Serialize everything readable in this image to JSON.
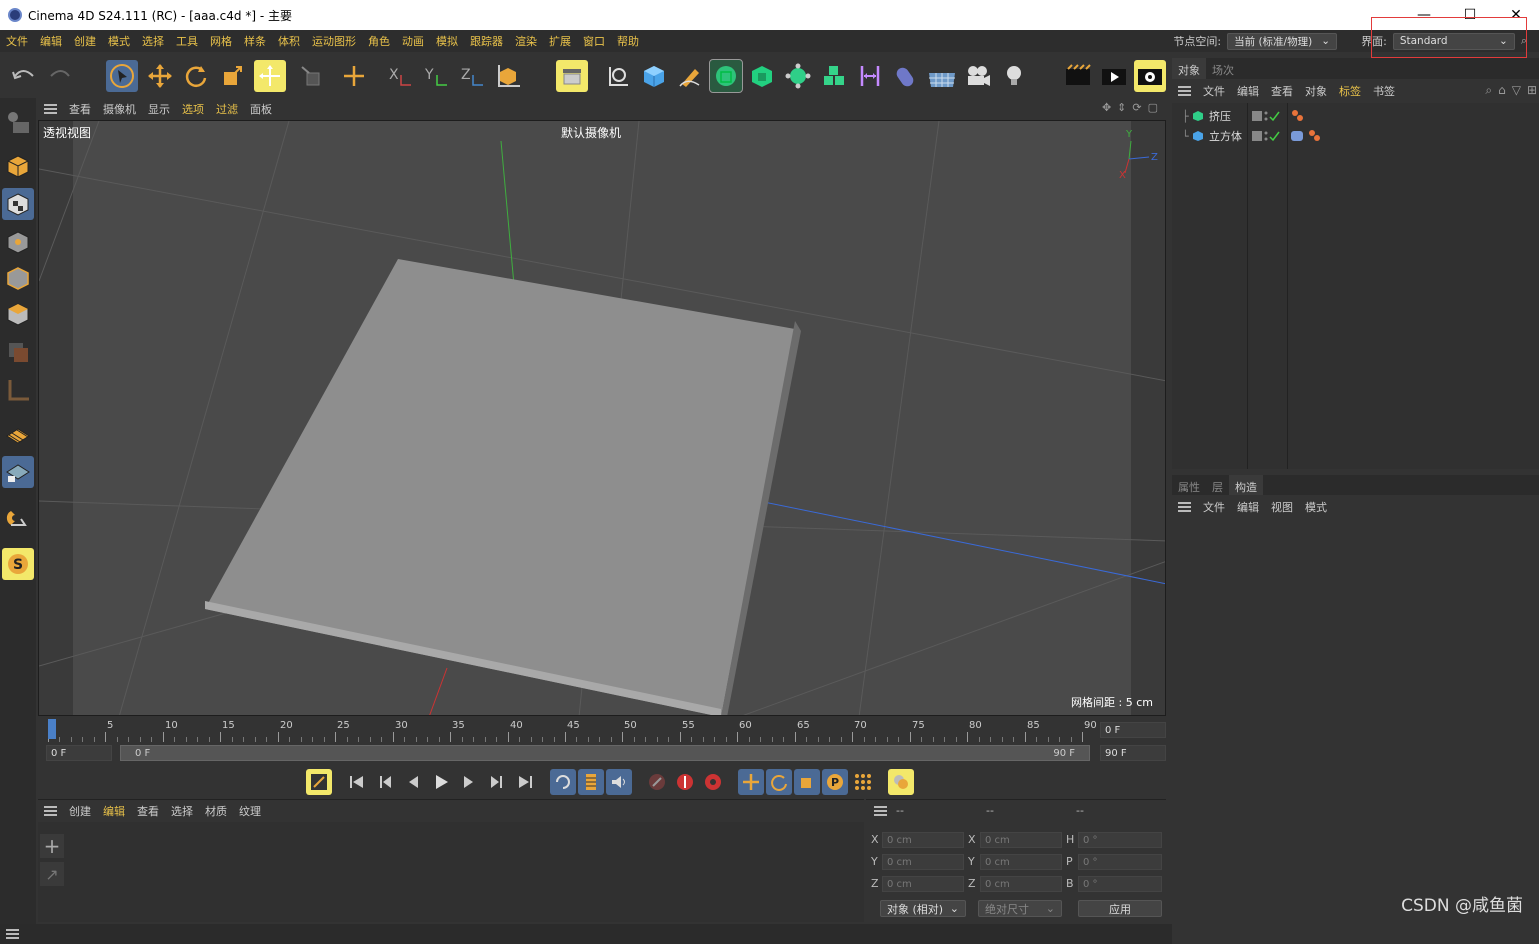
{
  "window": {
    "title": "Cinema 4D S24.111 (RC) - [aaa.c4d *] - 主要",
    "minimize": "—",
    "maximize": "☐",
    "close": "✕"
  },
  "menubar": {
    "items": [
      "文件",
      "编辑",
      "创建",
      "模式",
      "选择",
      "工具",
      "网格",
      "样条",
      "体积",
      "运动图形",
      "角色",
      "动画",
      "模拟",
      "跟踪器",
      "渲染",
      "扩展",
      "窗口",
      "帮助"
    ],
    "node_space_label": "节点空间:",
    "node_space_value": "当前 (标准/物理)",
    "layout_label": "界面:",
    "layout_value": "Standard"
  },
  "viewport": {
    "menu": [
      "查看",
      "摄像机",
      "显示",
      "选项",
      "过滤",
      "面板"
    ],
    "view_name": "透视视图",
    "camera": "默认摄像机",
    "grid_spacing": "网格间距 : 5 cm",
    "axis_y": "Y",
    "axis_z": "Z",
    "axis_x": "X"
  },
  "timeline": {
    "ticks": [
      "0",
      "5",
      "10",
      "15",
      "20",
      "25",
      "30",
      "35",
      "40",
      "45",
      "50",
      "55",
      "60",
      "65",
      "70",
      "75",
      "80",
      "85",
      "90"
    ],
    "current_frame": "0 F",
    "start_frame": "0 F",
    "range_start": "0 F",
    "range_end": "90 F",
    "end_frame": "90 F"
  },
  "materials": {
    "menu": [
      "创建",
      "编辑",
      "查看",
      "选择",
      "材质",
      "纹理"
    ]
  },
  "coords": {
    "headers": [
      "--",
      "--",
      "--"
    ],
    "rows": [
      {
        "l1": "X",
        "v1": "0 cm",
        "l2": "X",
        "v2": "0 cm",
        "l3": "H",
        "v3": "0 °"
      },
      {
        "l1": "Y",
        "v1": "0 cm",
        "l2": "Y",
        "v2": "0 cm",
        "l3": "P",
        "v3": "0 °"
      },
      {
        "l1": "Z",
        "v1": "0 cm",
        "l2": "Z",
        "v2": "0 cm",
        "l3": "B",
        "v3": "0 °"
      }
    ],
    "mode": "对象 (相对)",
    "size_mode": "绝对尺寸",
    "apply": "应用"
  },
  "objects": {
    "tabs": [
      "对象",
      "场次"
    ],
    "menu": [
      "文件",
      "编辑",
      "查看",
      "对象",
      "标签",
      "书签"
    ],
    "items": [
      {
        "name": "挤压"
      },
      {
        "name": "立方体"
      }
    ]
  },
  "attributes": {
    "tabs": [
      "属性",
      "层",
      "构造"
    ],
    "menu": [
      "文件",
      "编辑",
      "视图",
      "模式"
    ]
  },
  "watermark": "CSDN @咸鱼菌",
  "colors": {
    "accent_yellow": "#e9c24a",
    "highlight": "#f3e86a",
    "active_blue": "#4b6a95",
    "annotation_red": "#e23b3b"
  }
}
